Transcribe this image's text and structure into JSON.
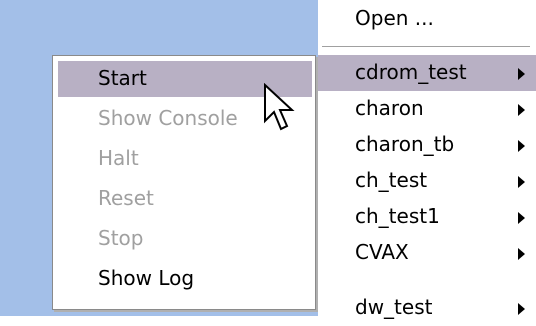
{
  "main_menu": {
    "open_label": "Open ...",
    "items": [
      {
        "label": "cdrom_test",
        "highlighted": true
      },
      {
        "label": "charon"
      },
      {
        "label": "charon_tb"
      },
      {
        "label": "ch_test"
      },
      {
        "label": "ch_test1"
      },
      {
        "label": "CVAX"
      },
      {
        "label": "dw_test"
      }
    ]
  },
  "context_menu": {
    "items": [
      {
        "label": "Start",
        "enabled": true,
        "highlighted": true
      },
      {
        "label": "Show Console",
        "enabled": false
      },
      {
        "label": "Halt",
        "enabled": false
      },
      {
        "label": "Reset",
        "enabled": false
      },
      {
        "label": "Stop",
        "enabled": false
      },
      {
        "label": "Show Log",
        "enabled": true
      }
    ]
  },
  "colors": {
    "highlight": "#b8b0c4",
    "disabled_text": "#a0a0a0",
    "desktop": "#a3bfe8"
  }
}
